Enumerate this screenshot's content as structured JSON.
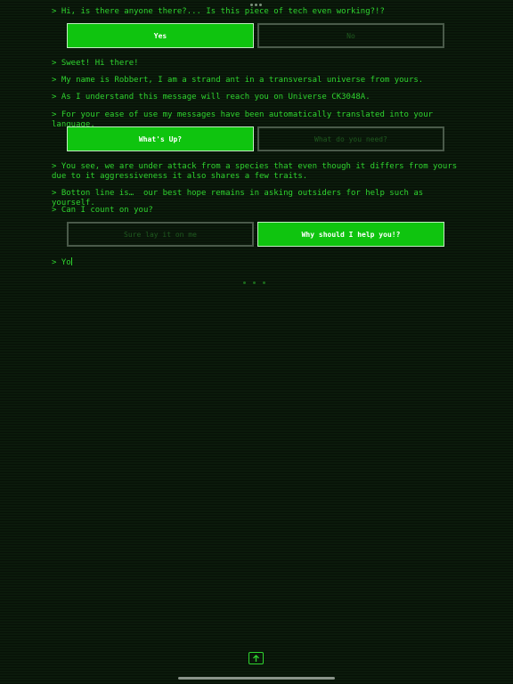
{
  "chat": {
    "messages": [
      "> Hi, is there anyone there?... Is this piece of tech even working?!?",
      "> Sweet! Hi there!",
      "> My name is Robbert, I am a strand ant in a transversal universe from yours.",
      "> As I understand this message will reach you on Universe CK3048A.",
      "> For your ease of use my messages have been automatically translated into your language.",
      "> You see, we are under attack from a species that even though it differs from yours due to it aggressiveness it also shares a few traits.",
      "> Botton line is…  our best hope remains in asking outsiders for help such as yourself.",
      "> Can I count on you?"
    ],
    "typing_text": "> Yo",
    "choices": [
      {
        "left": "Yes",
        "right": "No",
        "selected": "left"
      },
      {
        "left": "What's Up?",
        "right": "What do you need?",
        "selected": "left"
      },
      {
        "left": "Sure lay it on me",
        "right": "Why should I help you!?",
        "selected": "right"
      }
    ]
  },
  "colors": {
    "background": "#0b1a0b",
    "text": "#2fd42f",
    "active_button": "#0fc40f",
    "inactive_border": "#4a5a4a",
    "inactive_text": "#1f5a1f"
  },
  "icons": {
    "top_handle": "more-dots-icon",
    "typing": "typing-dots-icon",
    "share": "share-up-arrow-icon"
  }
}
